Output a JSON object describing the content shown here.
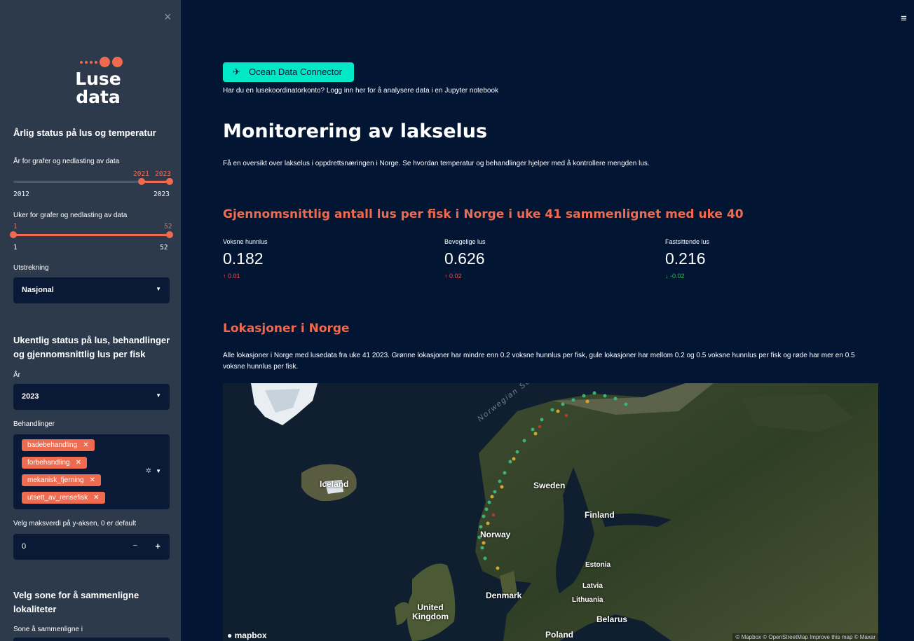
{
  "sidebar": {
    "close_symbol": "×",
    "logo": {
      "line1": "Luse",
      "line2": "data"
    },
    "section1_heading": "Årlig status på lus og temperatur",
    "year_slider": {
      "label": "År for grafer og nedlasting av data",
      "min": "2012",
      "max": "2023",
      "value_low": "2021",
      "value_high": "2023",
      "fraction_low": 0.82,
      "fraction_high": 1.0
    },
    "week_slider": {
      "label": "Uker for grafer og nedlasting av data",
      "min": "1",
      "max": "52",
      "value_low": "1",
      "value_high": "52"
    },
    "extent": {
      "label": "Utstrekning",
      "value": "Nasjonal"
    },
    "section2_heading": "Ukentlig status på lus, behandlinger og gjennomsnittlig lus per fisk",
    "year_select": {
      "label": "År",
      "value": "2023"
    },
    "treatments": {
      "label": "Behandlinger",
      "tags": [
        "badebehandling",
        "forbehandling",
        "mekanisk_fjerning",
        "utsett_av_rensefisk"
      ]
    },
    "y_axis": {
      "label": "Velg maksverdi på y-aksen, 0 er default",
      "value": "0",
      "minus": "−",
      "plus": "+"
    },
    "section3_heading": "Velg sone for å sammenligne lokaliteter",
    "zone_label": "Sone å sammenligne i"
  },
  "header": {
    "menu_icon": "hamburger-icon",
    "menu_symbol": "≡"
  },
  "main": {
    "connector_button": "Ocean Data Connector",
    "login_text": "Har du en lusekoordinatorkonto? Logg inn her for å analysere data i en Jupyter notebook",
    "title": "Monitorering av lakselus",
    "intro": "Få en oversikt over lakselus i oppdrettsnæringen i Norge. Se hvordan temperatur og behandlinger hjelper med å kontrollere mengden lus.",
    "avg_heading": "Gjennomsnittlig antall lus per fisk i Norge i uke 41 sammenlignet med uke 40",
    "metrics": [
      {
        "label": "Voksne hunnlus",
        "value": "0.182",
        "delta": "↑ 0.01",
        "direction": "up"
      },
      {
        "label": "Bevegelige lus",
        "value": "0.626",
        "delta": "↑ 0.02",
        "direction": "up"
      },
      {
        "label": "Fastsittende lus",
        "value": "0.216",
        "delta": "↓ -0.02",
        "direction": "down"
      }
    ],
    "locations_heading": "Lokasjoner i Norge",
    "locations_text": "Alle lokasjoner i Norge med lusedata fra uke 41 2023. Grønne lokasjoner har mindre enn 0.2 voksne hunnlus per fisk, gule lokasjoner har mellom 0.2 og 0.5 voksne hunnlus per fisk og røde har mer en 0.5 voksne hunnlus per fisk.",
    "map": {
      "sea_label": "Norwegian Se",
      "labels": {
        "iceland": "Iceland",
        "sweden": "Sweden",
        "finland": "Finland",
        "norway": "Norway",
        "estonia": "Estonia",
        "latvia": "Latvia",
        "lithuania": "Lithuania",
        "denmark": "Denmark",
        "uk": "United\nKingdom",
        "belarus": "Belarus",
        "poland": "Poland"
      },
      "logo_text": "mapbox",
      "attribution": "© Mapbox © OpenStreetMap Improve this map © Maxar",
      "colors": {
        "green": "#3cb371",
        "yellow": "#d4a72c",
        "red": "#c0392b"
      }
    }
  },
  "colors": {
    "accent": "#ef6b50",
    "background": "#021533",
    "sidebar": "#2c3a4c",
    "button": "#00e8c6"
  }
}
